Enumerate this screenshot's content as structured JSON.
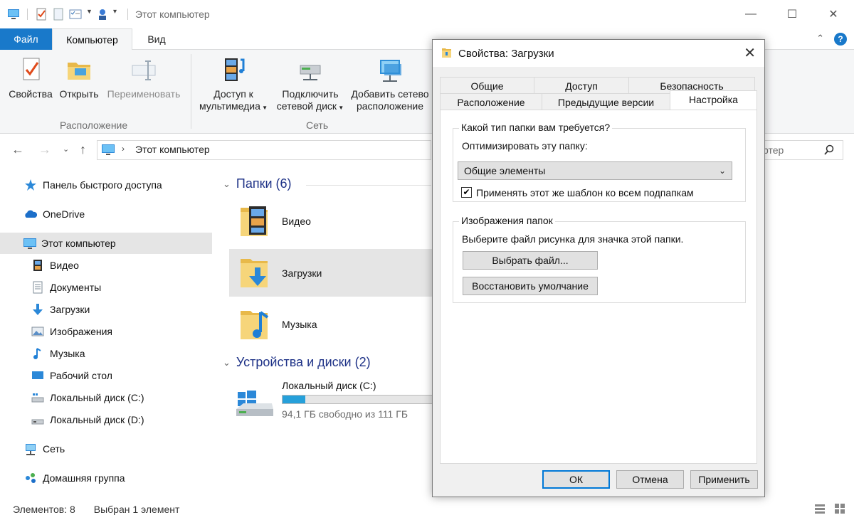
{
  "window": {
    "title": "Этот компьютер",
    "controls": [
      "minimize-icon",
      "maximize-icon",
      "close-icon"
    ]
  },
  "ribbon_tabs": {
    "file": "Файл",
    "computer": "Компьютер",
    "view": "Вид"
  },
  "ribbon": {
    "groups": [
      {
        "label": "Расположение",
        "buttons": [
          {
            "label": "Свойства",
            "icon": "properties-icon",
            "disabled": false
          },
          {
            "label": "Открыть",
            "icon": "open-folder-icon",
            "disabled": false
          },
          {
            "label": "Переименовать",
            "icon": "rename-icon",
            "disabled": true
          }
        ]
      },
      {
        "label": "Сеть",
        "buttons": [
          {
            "label_line1": "Доступ к",
            "label_line2": "мультимедиа",
            "icon": "media-access-icon",
            "dropdown": true
          },
          {
            "label_line1": "Подключить",
            "label_line2": "сетевой диск",
            "icon": "network-drive-icon",
            "dropdown": true
          },
          {
            "label_line1": "Добавить сетево",
            "label_line2": "расположение",
            "icon": "network-location-icon",
            "dropdown": false
          }
        ]
      }
    ]
  },
  "address": {
    "path": "Этот компьютер",
    "search_placeholder": "ртер"
  },
  "sidebar": {
    "items": [
      {
        "label": "Панель быстрого доступа",
        "icon": "star-icon"
      },
      {
        "label": "OneDrive",
        "icon": "cloud-icon"
      },
      {
        "label": "Этот компьютер",
        "icon": "computer-icon",
        "selected": true
      },
      {
        "label": "Видео",
        "icon": "video-icon"
      },
      {
        "label": "Документы",
        "icon": "document-icon"
      },
      {
        "label": "Загрузки",
        "icon": "download-icon"
      },
      {
        "label": "Изображения",
        "icon": "pictures-icon"
      },
      {
        "label": "Музыка",
        "icon": "music-icon"
      },
      {
        "label": "Рабочий стол",
        "icon": "desktop-icon"
      },
      {
        "label": "Локальный диск (C:)",
        "icon": "drive-icon"
      },
      {
        "label": "Локальный диск (D:)",
        "icon": "drive-icon"
      },
      {
        "label": "Сеть",
        "icon": "network-icon"
      },
      {
        "label": "Домашняя группа",
        "icon": "homegroup-icon"
      }
    ]
  },
  "main": {
    "folders_header": "Папки (6)",
    "folders": [
      {
        "label": "Видео",
        "icon": "video-folder-icon"
      },
      {
        "label": "Загрузки",
        "icon": "downloads-folder-icon",
        "selected": true
      },
      {
        "label": "Музыка",
        "icon": "music-folder-icon"
      }
    ],
    "devices_header": "Устройства и диски (2)",
    "drive": {
      "label": "Локальный диск (C:)",
      "free_text": "94,1 ГБ свободно из 111 ГБ",
      "used_fraction": 0.152
    }
  },
  "statusbar": {
    "items_count": "Элементов: 8",
    "selected": "Выбран 1 элемент"
  },
  "dialog": {
    "title": "Свойства: Загрузки",
    "tabs_row1": [
      "Общие",
      "Доступ",
      "Безопасность"
    ],
    "tabs_row2": [
      "Расположение",
      "Предыдущие версии",
      "Настройка"
    ],
    "active_tab": "Настройка",
    "folder_type_group": "Какой тип папки вам требуется?",
    "optimize_label": "Оптимизировать эту папку:",
    "optimize_value": "Общие элементы",
    "apply_template_label": "Применять этот же шаблон ко всем подпапкам",
    "apply_template_checked": true,
    "pictures_group": "Изображения папок",
    "pictures_hint": "Выберите файл рисунка для значка этой папки.",
    "choose_file_btn": "Выбрать файл...",
    "restore_default_btn": "Восстановить умолчание",
    "ok_btn": "ОК",
    "cancel_btn": "Отмена",
    "apply_btn": "Применить"
  },
  "colors": {
    "accent": "#1979ca",
    "section_header": "#1e3287",
    "selection": "#e5e5e5",
    "drive_fill": "#26a0da",
    "folder": "#f4d271"
  }
}
